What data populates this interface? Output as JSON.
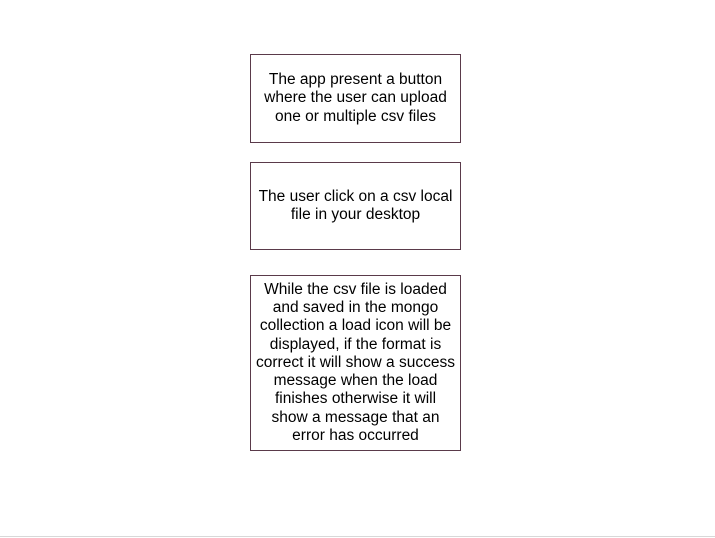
{
  "diagram": {
    "steps": [
      {
        "text": "The app present a button where the user can upload one or multiple csv files"
      },
      {
        "text": "The user click on a csv local file in your desktop"
      },
      {
        "text": "While the csv file is loaded and saved in the mongo collection a load icon will be displayed, if the format is correct it will show a success message when the load finishes otherwise it will show a message that an error has occurred"
      }
    ]
  }
}
